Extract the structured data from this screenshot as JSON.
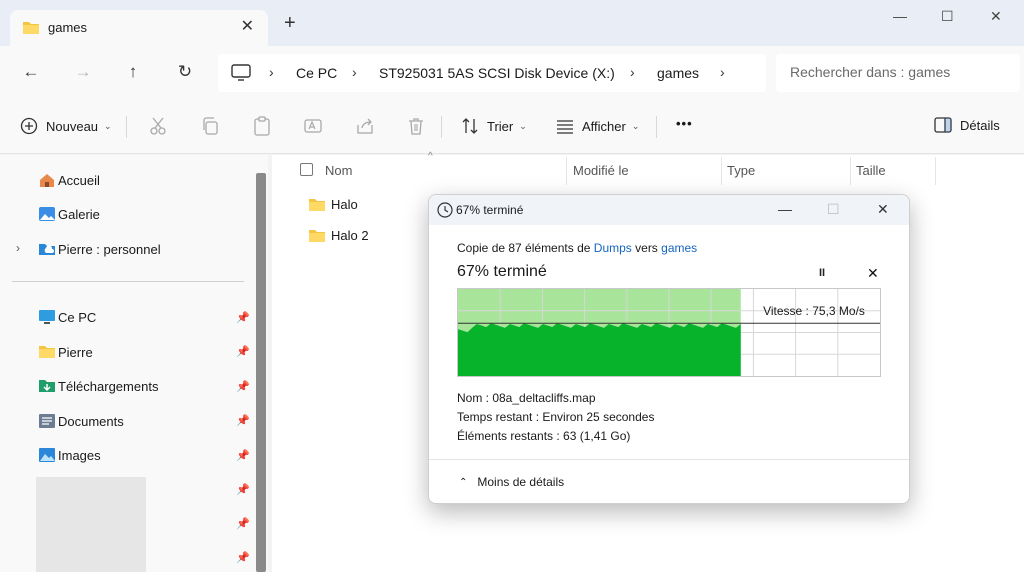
{
  "tab": {
    "title": "games",
    "new_tab": "+"
  },
  "window_controls": {
    "minimize": "—",
    "maximize": "☐",
    "close": "✕"
  },
  "breadcrumb": [
    "Ce PC",
    "ST925031 5AS SCSI Disk Device (X:)",
    "games"
  ],
  "search": {
    "placeholder": "Rechercher dans : games"
  },
  "toolbar": {
    "new_label": "Nouveau",
    "sort_label": "Trier",
    "view_label": "Afficher",
    "more": "•••",
    "details_label": "Détails"
  },
  "sidebar": {
    "top_items": [
      {
        "label": "Accueil",
        "icon": "home-icon"
      },
      {
        "label": "Galerie",
        "icon": "gallery-icon"
      },
      {
        "label": "Pierre : personnel",
        "icon": "cloud-folder-icon"
      }
    ],
    "pinned_items": [
      {
        "label": "Ce PC",
        "icon": "monitor-icon"
      },
      {
        "label": "Pierre",
        "icon": "folder-icon"
      },
      {
        "label": "Téléchargements",
        "icon": "download-folder-icon"
      },
      {
        "label": "Documents",
        "icon": "documents-icon"
      },
      {
        "label": "Images",
        "icon": "images-icon"
      }
    ]
  },
  "columns": {
    "name": "Nom",
    "modified": "Modifié le",
    "type": "Type",
    "size": "Taille"
  },
  "files": [
    {
      "name": "Halo"
    },
    {
      "name": "Halo 2"
    }
  ],
  "dialog": {
    "title": "67% terminé",
    "copy_prefix": "Copie de 87 éléments de",
    "source": "Dumps",
    "copy_mid": "vers",
    "destination": "games",
    "percent_text": "67% terminé",
    "progress": 0.67,
    "speed": "Vitesse : 75,3 Mo/s",
    "name_line": "Nom :  08a_deltacliffs.map",
    "time_line": "Temps restant :  Environ 25 secondes",
    "items_line": "Éléments restants :  63 (1,41 Go)",
    "less_details": "Moins de détails"
  },
  "colors": {
    "accent": "#1565c0",
    "progress_light": "#a8e49a",
    "progress_dark": "#06b32a",
    "folder": "#f4c542"
  }
}
